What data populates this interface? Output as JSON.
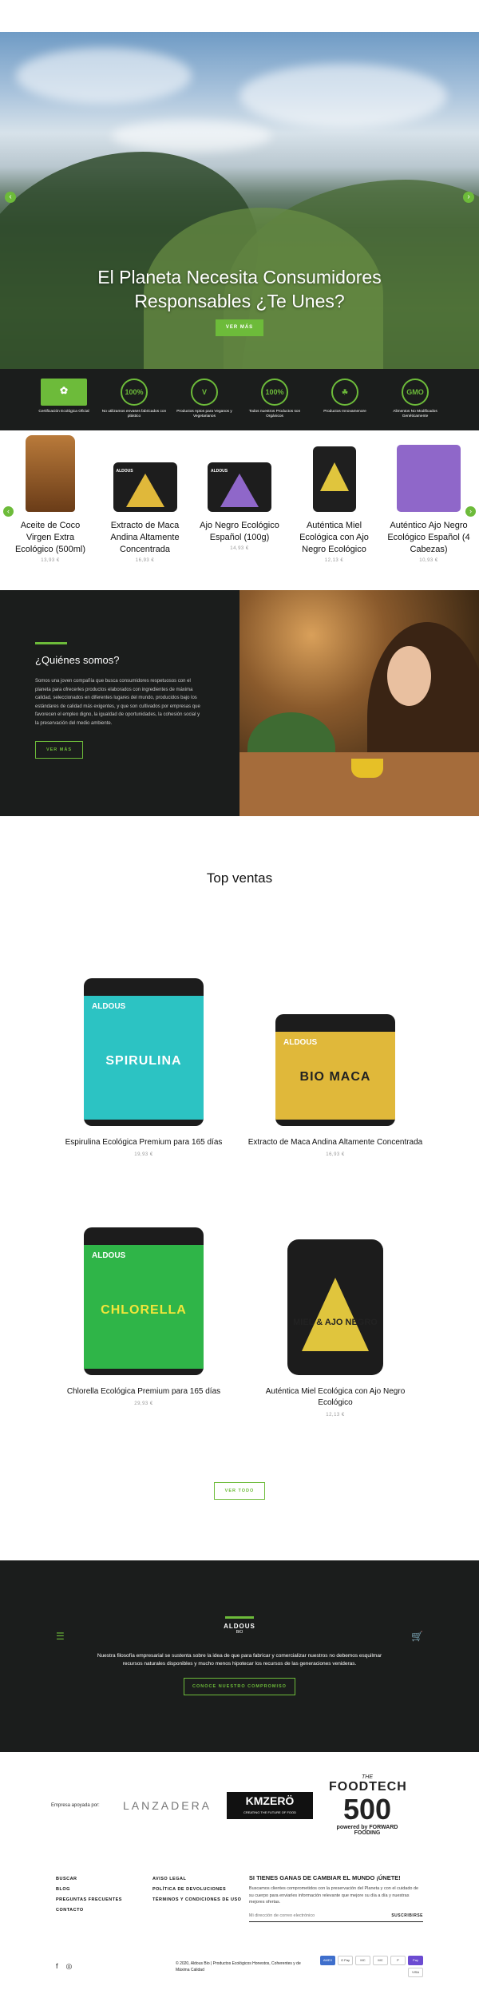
{
  "hero": {
    "title": "El Planeta Necesita Consumidores Responsables ¿Te Unes?",
    "button": "VER MÁS"
  },
  "badges": [
    {
      "icon": "eu-organic-leaf-icon",
      "glyph": "✿",
      "label": "Certificación Ecológica Oficial"
    },
    {
      "icon": "plastic-free-icon",
      "glyph": "100%",
      "label": "No utilizamos envases fabricados con plástico"
    },
    {
      "icon": "vegan-icon",
      "glyph": "V",
      "label": "Productos Aptos para Veganos y Vegetarianos"
    },
    {
      "icon": "organic-100-icon",
      "glyph": "100%",
      "label": "Todos nuestros Productos son Orgánicos"
    },
    {
      "icon": "sustainable-icon",
      "glyph": "☘",
      "label": "Productos Innovamenore"
    },
    {
      "icon": "no-gmo-icon",
      "glyph": "GMO",
      "label": "Alimentos No Modificados Genéticamente"
    }
  ],
  "carousel": [
    {
      "name": "Aceite de Coco Virgen Extra Ecológico (500ml)",
      "price": "13,93 €"
    },
    {
      "name": "Extracto de Maca Andina Altamente Concentrada",
      "price": "16,93 €"
    },
    {
      "name": "Ajo Negro Ecológico Español (100g)",
      "price": "14,93 €"
    },
    {
      "name": "Auténtica Miel Ecológica con Ajo Negro Ecológico",
      "price": "12,13 €"
    },
    {
      "name": "Auténtico Ajo Negro Ecológico Español (4 Cabezas)",
      "price": "10,93 €"
    }
  ],
  "about": {
    "title": "¿Quiénes somos?",
    "text": "Somos una joven compañía que busca consumidores respetuosos con el planeta para ofrecerles productos elaborados con ingredientes de máxima calidad, seleccionados en diferentes lugares del mundo, producidos bajo los estándares de calidad más exigentes, y que son cultivados por empresas que favorecen el empleo digno, la igualdad de oportunidades, la cohesión social y la preservación del medio ambiente.",
    "button": "VER MÁS"
  },
  "top_sellers": {
    "title": "Top ventas",
    "items": [
      {
        "name": "Espirulina Ecológica Premium para 165 días",
        "price": "19,93 €",
        "label": "SPIRULINA",
        "color": "#2cc3c3"
      },
      {
        "name": "Extracto de Maca Andina Altamente Concentrada",
        "price": "16,93 €",
        "label": "BIO MACA",
        "color": "#e0b83a"
      },
      {
        "name": "Chlorella Ecológica Premium para 165 días",
        "price": "29,93 €",
        "label": "CHLORELLA",
        "color": "#2fb548"
      },
      {
        "name": "Auténtica Miel Ecológica con Ajo Negro Ecológico",
        "price": "12,13 €",
        "label": "MIEL & AJO NEGRO",
        "color": "#e0c53d"
      }
    ],
    "see_all": "VER TODO"
  },
  "philosophy": {
    "brand": "ALDOUS",
    "brand_sub": "BIO",
    "text": "Nuestra filosofía empresarial se sustenta sobre la idea de que para fabricar y comercializar nuestros no debemos esquilmar recursos naturales disponibles y mucho menos hipotecar los recursos de las generaciones venideras.",
    "button": "CONOCE NUESTRO COMPROMISO"
  },
  "sponsors": {
    "label": "Empresa apoyada por:",
    "lanzadera": "LANZADERA",
    "kmzero": "KMZERÖ",
    "kmzero_sub": "CREATING THE FUTURE OF FOOD",
    "foodtech_the": "THE",
    "foodtech": "FOODTECH",
    "foodtech_num": "500",
    "foodtech_powered": "powered by FORWARD FOODING"
  },
  "footer": {
    "col1": [
      "BUSCAR",
      "BLOG",
      "PREGUNTAS FRECUENTES",
      "CONTACTO"
    ],
    "col2": [
      "AVISO LEGAL",
      "POLÍTICA DE DEVOLUCIONES",
      "TÉRMINOS Y CONDICIONES DE USO"
    ],
    "newsletter_title": "SI TIENES GANAS DE CAMBIAR EL MUNDO ¡ÚNETE!",
    "newsletter_text": "Buscamos clientes comprometidos con la preservación del Planeta y con el cuidado de su cuerpo para enviarles información relevante que mejore su día a día y nuestras mejores ofertas.",
    "email_placeholder": "Mi dirección de correo electrónico",
    "subscribe": "SUSCRIBIRSE",
    "copyright_prefix": "© 2020, ",
    "copyright_link": "Aldous Bio | Productos Ecológicos Honestos, Coherentes y de Máxima Calidad",
    "payments": [
      "AMEX",
      "G Pay",
      "MC",
      "MC",
      "P",
      "Pay",
      "VISA"
    ]
  }
}
